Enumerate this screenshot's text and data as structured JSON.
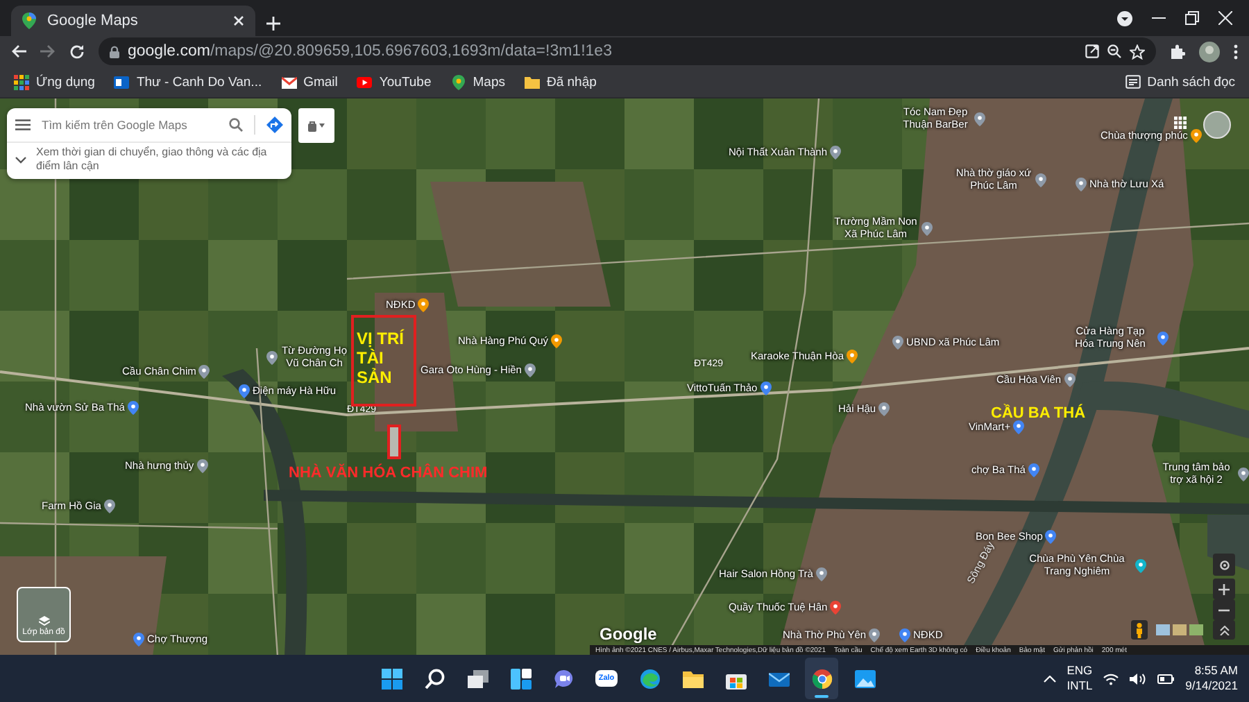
{
  "browser": {
    "tab_title": "Google Maps",
    "url_host": "google.com",
    "url_path": "/maps/@20.809659,105.6967603,1693m/data=!3m1!1e3",
    "bookmarks": [
      {
        "kind": "apps",
        "label": "Ứng dụng"
      },
      {
        "kind": "mail",
        "label": "Thư - Canh Do Van..."
      },
      {
        "kind": "gmail",
        "label": "Gmail"
      },
      {
        "kind": "youtube",
        "label": "YouTube"
      },
      {
        "kind": "maps",
        "label": "Maps"
      },
      {
        "kind": "folder",
        "label": "Đã nhập"
      }
    ],
    "reading_list": "Danh sách đọc"
  },
  "map": {
    "search": {
      "placeholder": "Tìm kiếm trên Google Maps"
    },
    "hint": "Xem thời gian di chuyển, giao thông và các địa điểm lân cận",
    "labels": [
      {
        "kind": "place",
        "text": "Tóc Nam Đẹp Thuận BarBer",
        "color": "#8e9aa8"
      },
      {
        "kind": "place",
        "text": "Chùa thượng phúc",
        "color": "#f29900"
      },
      {
        "kind": "place",
        "text": "Nội Thất Xuân Thành",
        "color": "#8e9aa8"
      },
      {
        "kind": "place",
        "text": "Nhà thờ giáo xứ Phúc Lâm",
        "color": "#8e9aa8"
      },
      {
        "kind": "place",
        "text": "Nhà thờ Lưu Xá",
        "color": "#8e9aa8"
      },
      {
        "kind": "place",
        "text": "Trường Mầm Non Xã Phúc Lâm",
        "color": "#8e9aa8"
      },
      {
        "kind": "place",
        "text": "NĐKD",
        "color": "#f29900"
      },
      {
        "kind": "place",
        "text": "Nhà Hàng Phú Quý",
        "color": "#f29900"
      },
      {
        "kind": "place",
        "text": "Cầu Chân Chim",
        "color": "#8e9aa8"
      },
      {
        "kind": "place",
        "text": "Từ Đường Họ Vũ Chân Ch",
        "color": "#8e9aa8"
      },
      {
        "kind": "place",
        "text": "Gara Oto Hùng - Hiền",
        "color": "#8e9aa8"
      },
      {
        "kind": "place",
        "text": "Điện máy Hà Hữu",
        "color": "#4285f4"
      },
      {
        "kind": "place",
        "text": "Nhà vườn Sử Ba Thá",
        "color": "#4285f4"
      },
      {
        "kind": "road",
        "text": "ĐT429"
      },
      {
        "kind": "place",
        "text": "Nhà hưng thủy",
        "color": "#8e9aa8"
      },
      {
        "kind": "place",
        "text": "Farm Hồ Gia",
        "color": "#8e9aa8"
      },
      {
        "kind": "place",
        "text": "Chợ Thượng",
        "color": "#4285f4"
      },
      {
        "kind": "place",
        "text": "UBND xã Phúc Lâm",
        "color": "#8e9aa8"
      },
      {
        "kind": "place",
        "text": "Cửa Hàng Tạp Hóa Trung Nên",
        "color": "#4285f4"
      },
      {
        "kind": "place",
        "text": "Karaoke Thuận Hòa",
        "color": "#f29900"
      },
      {
        "kind": "place",
        "text": "Cầu Hòa Viên",
        "color": "#8e9aa8"
      },
      {
        "kind": "road",
        "text": "ĐT429"
      },
      {
        "kind": "place",
        "text": "VittoTuấn Thảo",
        "color": "#4285f4"
      },
      {
        "kind": "place",
        "text": "Hải Hậu",
        "color": "#8e9aa8"
      },
      {
        "kind": "place",
        "text": "VinMart+",
        "color": "#4285f4"
      },
      {
        "kind": "place",
        "text": "chợ Ba Thá",
        "color": "#4285f4"
      },
      {
        "kind": "place",
        "text": "Trung tâm bảo trợ xã hội 2",
        "color": "#8e9aa8"
      },
      {
        "kind": "place",
        "text": "Bon Bee Shop",
        "color": "#4285f4"
      },
      {
        "kind": "place",
        "text": "Hair Salon Hồng Trà",
        "color": "#8e9aa8"
      },
      {
        "kind": "place",
        "text": "Chùa Phù Yên Chùa Trang Nghiêm",
        "color": "#12b5cb"
      },
      {
        "kind": "place",
        "text": "Quầy Thuốc Tuệ Hân",
        "color": "#ea4335"
      },
      {
        "kind": "place",
        "text": "Nhà Thờ Phù Yên",
        "color": "#8e9aa8"
      },
      {
        "kind": "place",
        "text": "NĐKD",
        "color": "#4285f4"
      },
      {
        "kind": "river",
        "text": "Sông Đáy"
      }
    ],
    "annotations": [
      {
        "text": "VỊ TRÍ TÀI SẢN",
        "color": "#ffee00",
        "framed": true
      },
      {
        "text": "NHÀ VĂN HÓA CHÂN CHIM",
        "color": "#ff2a2a",
        "framed": false
      },
      {
        "text": "CẦU BA THÁ",
        "color": "#ffee00",
        "framed": false
      }
    ],
    "layers_button": "Lớp bản đồ",
    "logo": "Google",
    "attribution": [
      "Hình ảnh ©2021 CNES / Airbus,Maxar Technologies,Dữ liệu bản đồ ©2021",
      "Toàn cầu",
      "Chế độ xem Earth 3D không có",
      "Điều khoản",
      "Bảo mật",
      "Gửi phản hồi",
      "200 mét"
    ]
  },
  "taskbar": {
    "apps": [
      {
        "kind": "start",
        "active": false
      },
      {
        "kind": "search",
        "active": false
      },
      {
        "kind": "taskview",
        "active": false
      },
      {
        "kind": "widgets",
        "active": false
      },
      {
        "kind": "chat",
        "active": false
      },
      {
        "kind": "zalo",
        "active": false
      },
      {
        "kind": "edge",
        "active": false
      },
      {
        "kind": "explorer",
        "active": false
      },
      {
        "kind": "store",
        "active": false
      },
      {
        "kind": "mail",
        "active": false
      },
      {
        "kind": "chrome",
        "active": true
      },
      {
        "kind": "photos",
        "active": false
      }
    ],
    "zalo_label": "Zalo",
    "language": "ENG",
    "layout": "INTL",
    "time": "8:55 AM",
    "date": "9/14/2021"
  }
}
